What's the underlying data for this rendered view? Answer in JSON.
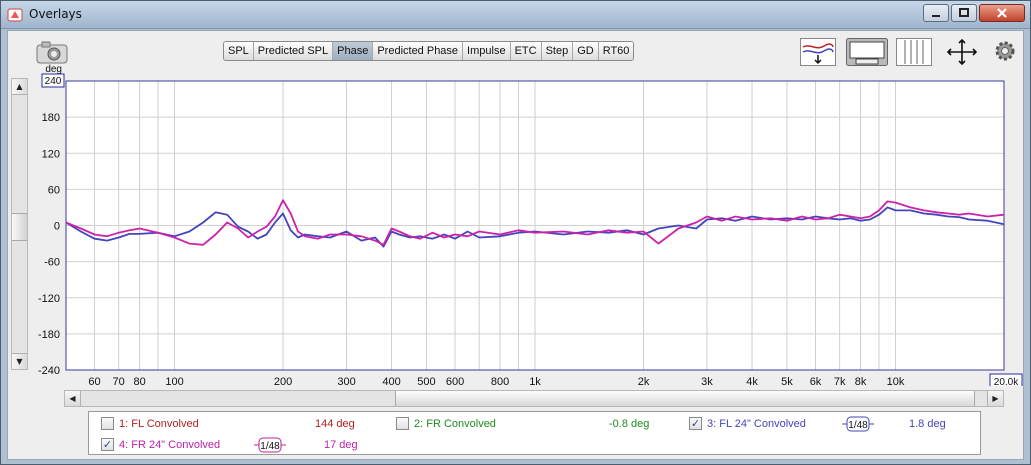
{
  "window": {
    "title": "Overlays",
    "buttons": {
      "minimize": "minimize",
      "maximize": "maximize",
      "close": "close"
    }
  },
  "tabs": [
    {
      "label": "SPL",
      "selected": false
    },
    {
      "label": "Predicted SPL",
      "selected": false
    },
    {
      "label": "Phase",
      "selected": true
    },
    {
      "label": "Predicted Phase",
      "selected": false
    },
    {
      "label": "Impulse",
      "selected": false
    },
    {
      "label": "ETC",
      "selected": false
    },
    {
      "label": "Step",
      "selected": false
    },
    {
      "label": "GD",
      "selected": false
    },
    {
      "label": "RT60",
      "selected": false
    }
  ],
  "toolbar_icons": [
    "trace-arrange-icon",
    "controls-panel-icon",
    "vertical-lines-icon",
    "fit-axes-icon",
    "settings-gear-icon"
  ],
  "chart_data": {
    "type": "line",
    "y_unit": "deg",
    "ylim": [
      -240,
      240
    ],
    "xlim": [
      50,
      20000
    ],
    "x_scale": "log",
    "yticks": [
      "240",
      "180",
      "120",
      "60",
      "0",
      "-60",
      "-120",
      "-180",
      "-240"
    ],
    "xticks": [
      {
        "value": 60,
        "label": "60"
      },
      {
        "value": 70,
        "label": "70"
      },
      {
        "value": 80,
        "label": "80"
      },
      {
        "value": 100,
        "label": "100"
      },
      {
        "value": 200,
        "label": "200"
      },
      {
        "value": 300,
        "label": "300"
      },
      {
        "value": 400,
        "label": "400"
      },
      {
        "value": 500,
        "label": "500"
      },
      {
        "value": 600,
        "label": "600"
      },
      {
        "value": 800,
        "label": "800"
      },
      {
        "value": 1000,
        "label": "1k"
      },
      {
        "value": 2000,
        "label": "2k"
      },
      {
        "value": 3000,
        "label": "3k"
      },
      {
        "value": 4000,
        "label": "4k"
      },
      {
        "value": 5000,
        "label": "5k"
      },
      {
        "value": 6000,
        "label": "6k"
      },
      {
        "value": 7000,
        "label": "7k"
      },
      {
        "value": 8000,
        "label": "8k"
      },
      {
        "value": 10000,
        "label": "10k"
      },
      {
        "value": 20000,
        "label": "20"
      }
    ],
    "y_top_box": "240",
    "x_right_box": "20.0k",
    "series": [
      {
        "name": "3: FL 24\" Convolved",
        "color": "#4444bb",
        "x": [
          50,
          55,
          60,
          65,
          70,
          75,
          80,
          90,
          100,
          110,
          120,
          130,
          140,
          150,
          160,
          170,
          180,
          190,
          200,
          210,
          220,
          230,
          250,
          270,
          300,
          330,
          360,
          380,
          400,
          420,
          450,
          480,
          520,
          560,
          600,
          650,
          700,
          800,
          900,
          1000,
          1200,
          1400,
          1600,
          1800,
          2000,
          2200,
          2500,
          2800,
          3000,
          3300,
          3600,
          4000,
          4500,
          5000,
          5500,
          6000,
          6500,
          7000,
          7500,
          8000,
          8500,
          9000,
          9500,
          10000,
          11000,
          12000,
          13000,
          14000,
          15000,
          16000,
          18000,
          20000
        ],
        "y": [
          5,
          -10,
          -22,
          -25,
          -20,
          -14,
          -14,
          -12,
          -18,
          -10,
          5,
          22,
          18,
          -2,
          -10,
          -22,
          -15,
          5,
          20,
          -8,
          -20,
          -15,
          -18,
          -20,
          -10,
          -25,
          -20,
          -35,
          -10,
          -15,
          -20,
          -18,
          -22,
          -15,
          -22,
          -10,
          -20,
          -18,
          -12,
          -10,
          -15,
          -10,
          -12,
          -8,
          -15,
          -5,
          0,
          -5,
          10,
          12,
          8,
          15,
          10,
          12,
          10,
          15,
          12,
          10,
          12,
          8,
          10,
          18,
          30,
          25,
          25,
          20,
          18,
          15,
          14,
          10,
          8,
          2
        ]
      },
      {
        "name": "4: FR 24\" Convolved",
        "color": "#cc22aa",
        "x": [
          50,
          55,
          60,
          65,
          70,
          75,
          80,
          90,
          100,
          110,
          120,
          130,
          140,
          150,
          160,
          170,
          180,
          190,
          200,
          210,
          220,
          230,
          250,
          270,
          300,
          330,
          360,
          380,
          400,
          420,
          450,
          480,
          520,
          560,
          600,
          650,
          700,
          800,
          900,
          1000,
          1200,
          1400,
          1600,
          1800,
          2000,
          2200,
          2500,
          2800,
          3000,
          3300,
          3600,
          4000,
          4500,
          5000,
          5500,
          6000,
          6500,
          7000,
          7500,
          8000,
          8500,
          9000,
          9500,
          10000,
          11000,
          12000,
          13000,
          14000,
          15000,
          16000,
          18000,
          20000
        ],
        "y": [
          5,
          -5,
          -15,
          -18,
          -12,
          -8,
          -5,
          -12,
          -20,
          -30,
          -32,
          -15,
          5,
          -5,
          -20,
          -10,
          -2,
          15,
          42,
          20,
          -10,
          -18,
          -22,
          -15,
          -15,
          -18,
          -25,
          -32,
          -5,
          -10,
          -18,
          -22,
          -12,
          -20,
          -15,
          -18,
          -10,
          -15,
          -8,
          -12,
          -10,
          -15,
          -8,
          -12,
          -10,
          -30,
          -5,
          5,
          15,
          8,
          15,
          10,
          12,
          8,
          15,
          10,
          12,
          18,
          15,
          12,
          15,
          25,
          40,
          38,
          30,
          25,
          22,
          20,
          18,
          20,
          15,
          18
        ]
      }
    ]
  },
  "legend": {
    "items": [
      {
        "label": "1: FL Convolved",
        "value": "144 deg",
        "checked": false,
        "color": "#b22222"
      },
      {
        "label": "2: FR Convolved",
        "value": "-0.8 deg",
        "checked": false,
        "color": "#1f8a1f"
      },
      {
        "label": "3: FL 24\" Convolved",
        "value": "1.8 deg",
        "checked": true,
        "color": "#4444bb",
        "smoothing": "1/48"
      },
      {
        "label": "4: FR 24\" Convolved",
        "value": "17 deg",
        "checked": true,
        "color": "#bb22aa",
        "smoothing": "1/48"
      }
    ]
  },
  "camera_label": "camera",
  "colors": {
    "plot_border": "#3b3b9a",
    "grid": "#c8c8c8",
    "axis_box": "#2a2aa0"
  }
}
